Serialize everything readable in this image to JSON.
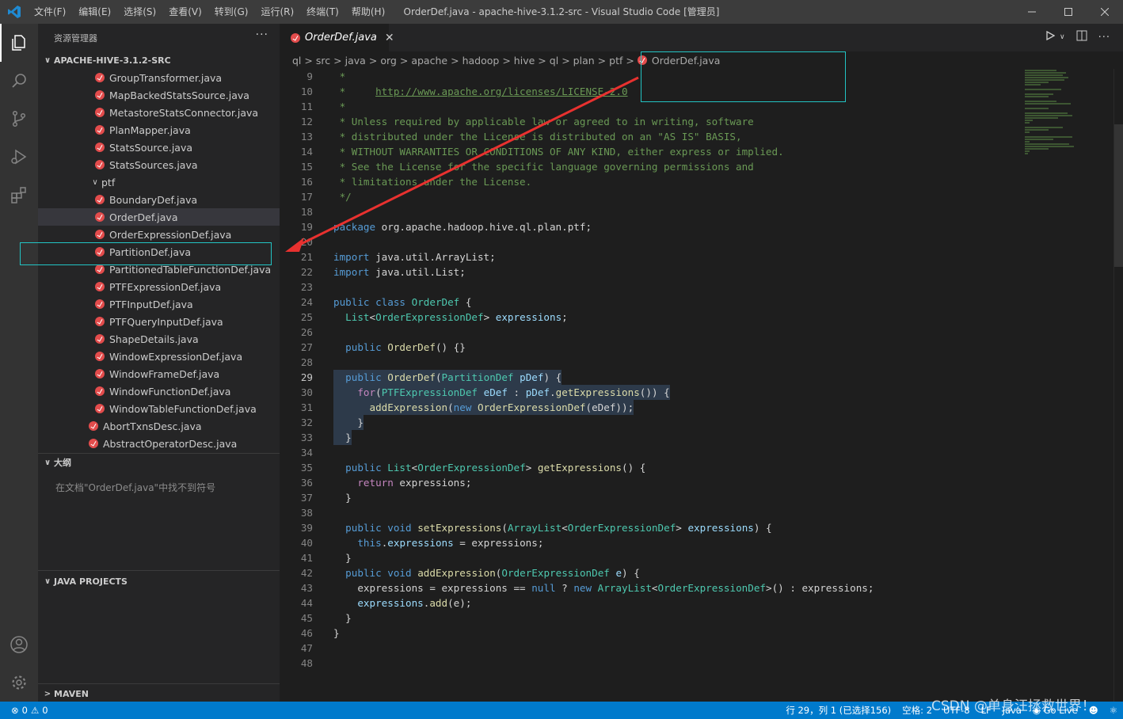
{
  "titlebar": {
    "menus": [
      "文件(F)",
      "编辑(E)",
      "选择(S)",
      "查看(V)",
      "转到(G)",
      "运行(R)",
      "终端(T)",
      "帮助(H)"
    ],
    "window_title": "OrderDef.java - apache-hive-3.1.2-src - Visual Studio Code [管理员]"
  },
  "sidebar": {
    "header": "资源管理器",
    "more": "···",
    "root_folder": "APACHE-HIVE-3.1.2-SRC",
    "files_before_ptf": [
      "GroupTransformer.java",
      "MapBackedStatsSource.java",
      "MetastoreStatsConnector.java",
      "PlanMapper.java",
      "StatsSource.java",
      "StatsSources.java"
    ],
    "ptf_folder": "ptf",
    "ptf_files": [
      "BoundaryDef.java",
      "OrderDef.java",
      "OrderExpressionDef.java",
      "PartitionDef.java",
      "PartitionedTableFunctionDef.java",
      "PTFExpressionDef.java",
      "PTFInputDef.java",
      "PTFQueryInputDef.java",
      "ShapeDetails.java",
      "WindowExpressionDef.java",
      "WindowFrameDef.java",
      "WindowFunctionDef.java",
      "WindowTableFunctionDef.java"
    ],
    "files_after_ptf": [
      "AbortTxnsDesc.java",
      "AbstractOperatorDesc.java"
    ],
    "selected_file": "OrderDef.java",
    "outline_title": "大纲",
    "outline_message": "在文档\"OrderDef.java\"中找不到符号",
    "java_projects_title": "JAVA PROJECTS",
    "maven_title": "MAVEN"
  },
  "editor": {
    "tab_label": "OrderDef.java",
    "breadcrumb": [
      "ql",
      "src",
      "java",
      "org",
      "apache",
      "hadoop",
      "hive",
      "ql",
      "plan",
      "ptf",
      "OrderDef.java"
    ],
    "current_line": 29
  },
  "statusbar": {
    "errors": "0",
    "warnings": "0",
    "position": "行 29，列 1 (已选择156)",
    "spaces": "空格: 2",
    "encoding": "UTF-8",
    "eol": "LF",
    "language": "Java",
    "golive": "Go Live"
  },
  "watermark": "CSDN @单身汪拯救世界！"
}
